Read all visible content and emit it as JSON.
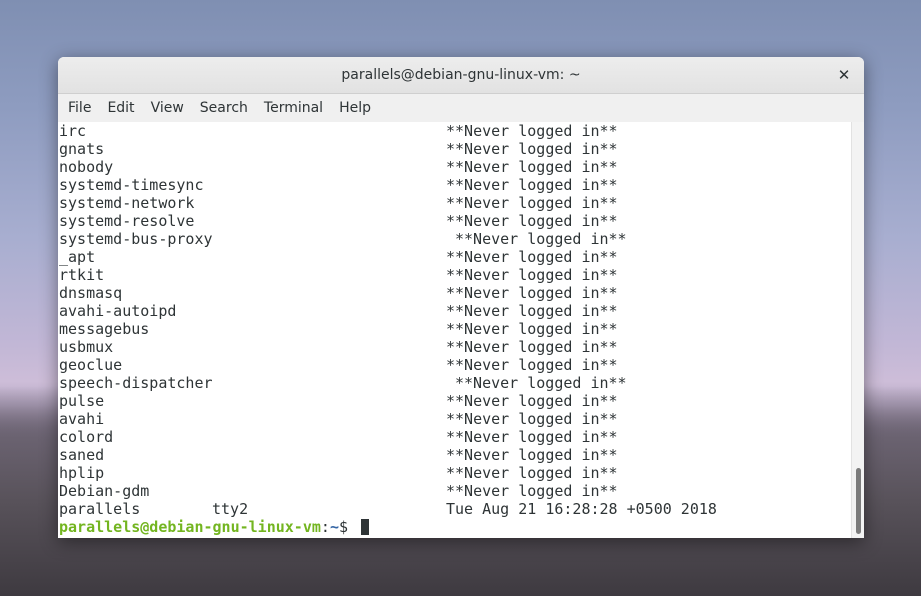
{
  "window": {
    "title": "parallels@debian-gnu-linux-vm: ~",
    "close_glyph": "✕"
  },
  "menu": [
    "File",
    "Edit",
    "View",
    "Search",
    "Terminal",
    "Help"
  ],
  "terminal": {
    "lines": [
      {
        "user": "irc",
        "port": "",
        "latest": "**Never logged in**"
      },
      {
        "user": "gnats",
        "port": "",
        "latest": "**Never logged in**"
      },
      {
        "user": "nobody",
        "port": "",
        "latest": "**Never logged in**"
      },
      {
        "user": "systemd-timesync",
        "port": "",
        "latest": "**Never logged in**"
      },
      {
        "user": "systemd-network",
        "port": "",
        "latest": "**Never logged in**"
      },
      {
        "user": "systemd-resolve",
        "port": "",
        "latest": "**Never logged in**"
      },
      {
        "user": "systemd-bus-proxy",
        "port": "",
        "latest": "**Never logged in**"
      },
      {
        "user": "_apt",
        "port": "",
        "latest": "**Never logged in**"
      },
      {
        "user": "rtkit",
        "port": "",
        "latest": "**Never logged in**"
      },
      {
        "user": "dnsmasq",
        "port": "",
        "latest": "**Never logged in**"
      },
      {
        "user": "avahi-autoipd",
        "port": "",
        "latest": "**Never logged in**"
      },
      {
        "user": "messagebus",
        "port": "",
        "latest": "**Never logged in**"
      },
      {
        "user": "usbmux",
        "port": "",
        "latest": "**Never logged in**"
      },
      {
        "user": "geoclue",
        "port": "",
        "latest": "**Never logged in**"
      },
      {
        "user": "speech-dispatcher",
        "port": "",
        "latest": "**Never logged in**"
      },
      {
        "user": "pulse",
        "port": "",
        "latest": "**Never logged in**"
      },
      {
        "user": "avahi",
        "port": "",
        "latest": "**Never logged in**"
      },
      {
        "user": "colord",
        "port": "",
        "latest": "**Never logged in**"
      },
      {
        "user": "saned",
        "port": "",
        "latest": "**Never logged in**"
      },
      {
        "user": "hplip",
        "port": "",
        "latest": "**Never logged in**"
      },
      {
        "user": "Debian-gdm",
        "port": "",
        "latest": "**Never logged in**"
      },
      {
        "user": "parallels",
        "port": "tty2",
        "latest": "Tue Aug 21 16:28:28 +0500 2018"
      }
    ],
    "prompt": {
      "user_host": "parallels@debian-gnu-linux-vm",
      "colon": ":",
      "path": "~",
      "symbol": "$ "
    }
  }
}
